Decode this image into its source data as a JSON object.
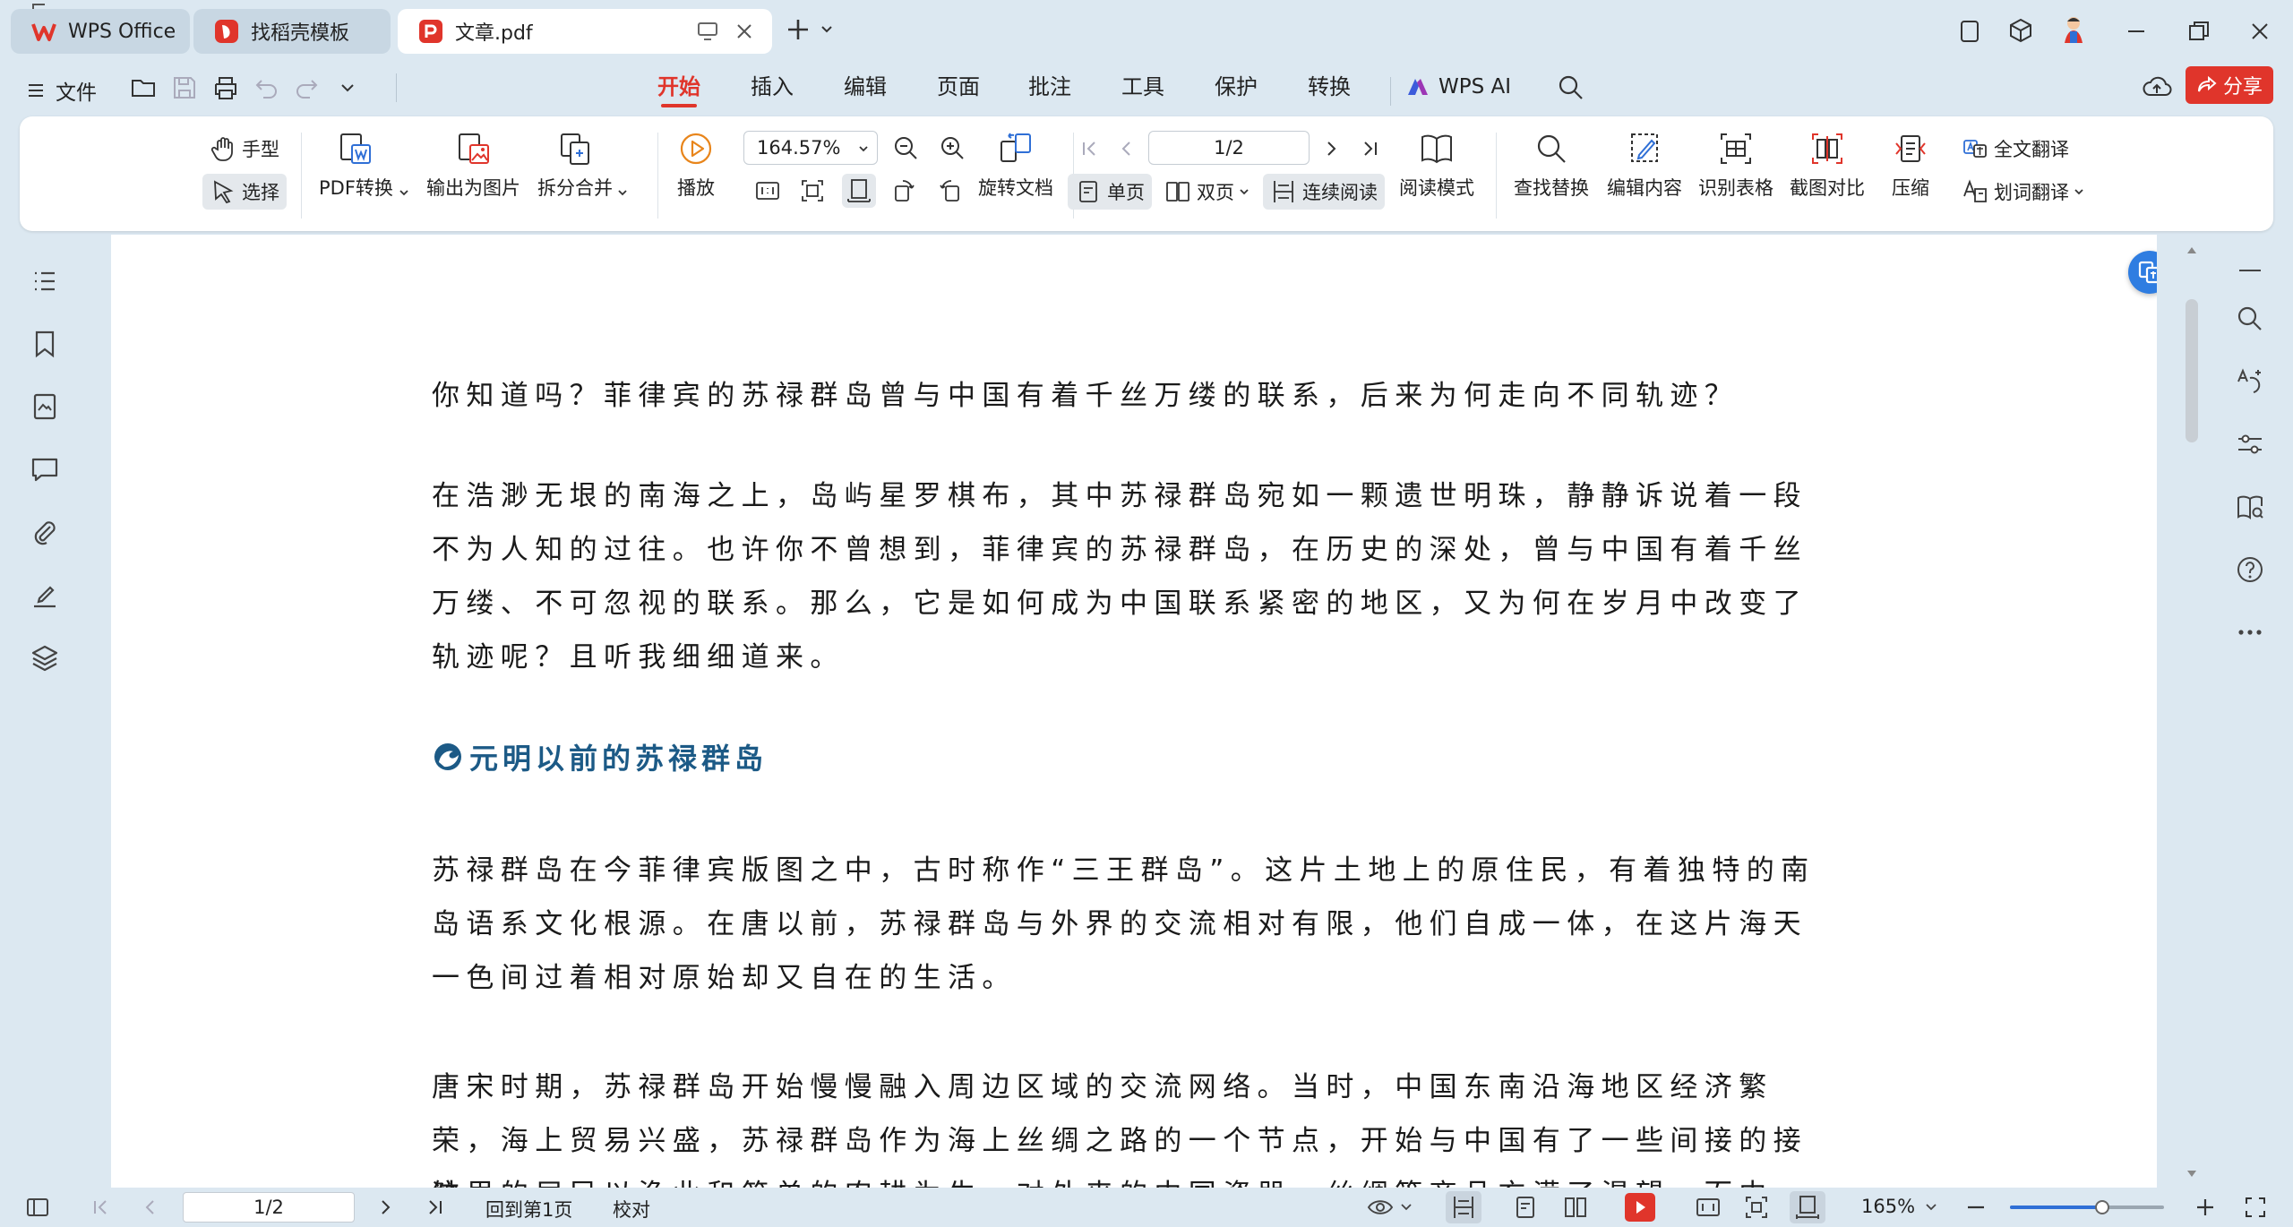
{
  "tabs": [
    {
      "label": "WPS Office",
      "icon": "wps-logo-icon",
      "color": "#e0352b"
    },
    {
      "label": "找稻壳模板",
      "icon": "docer-icon",
      "color": "#e0352b"
    },
    {
      "label": "文章.pdf",
      "icon": "pdf-icon",
      "color": "#e0352b"
    }
  ],
  "menu": {
    "file_label": "文件",
    "tabs": [
      "开始",
      "插入",
      "编辑",
      "页面",
      "批注",
      "工具",
      "保护",
      "转换"
    ],
    "ai_label": "WPS AI",
    "share_label": "分享",
    "accent": "#e0352b"
  },
  "ribbon": {
    "hand": "手型",
    "select": "选择",
    "pdf_convert": "PDF转换",
    "export_image": "输出为图片",
    "split_merge": "拆分合并",
    "play": "播放",
    "zoom_value": "164.57%",
    "page_value": "1/2",
    "rotate_doc": "旋转文档",
    "single_page": "单页",
    "double_page": "双页",
    "continuous": "连续阅读",
    "read_mode": "阅读模式",
    "find_replace": "查找替换",
    "edit_content": "编辑内容",
    "recognize_table": "识别表格",
    "screenshot_compare": "截图对比",
    "compress": "压缩",
    "full_translate": "全文翻译",
    "word_translate": "划词翻译"
  },
  "document": {
    "p1": "你知道吗？菲律宾的苏禄群岛曾与中国有着千丝万缕的联系，后来为何走向不同轨迹？",
    "p2": "在浩渺无垠的南海之上，岛屿星罗棋布，其中苏禄群岛宛如一颗遗世明珠，静静诉说着一段不为人知的过往。也许你不曾想到，菲律宾的苏禄群岛，在历史的深处，曾与中国有着千丝万缕、不可忽视的联系。那么，它是如何成为中国联系紧密的地区，又为何在岁月中改变了轨迹呢？且听我细细道来。",
    "heading": "元明以前的苏禄群岛",
    "p3": "苏禄群岛在今菲律宾版图之中，古时称作“三王群岛”。这片土地上的原住民，有着独特的南岛语系文化根源。在唐以前，苏禄群岛与外界的交流相对有限，他们自成一体，在这片海天一色间过着相对原始却又自在的生活。",
    "p4": "唐宋时期，苏禄群岛开始慢慢融入周边区域的交流网络。当时，中国东南沿海地区经济繁荣，海上贸易兴盛，苏禄群岛作为海上丝绸之路的一个节点，开始与中国有了一些间接的接触。",
    "p5_partial": "这里的居民以渔业和简单的农耕为生，对外来的中国瓷器、丝绸等商品充满了渴望，而中"
  },
  "status": {
    "page_value": "1/2",
    "back_first": "回到第1页",
    "proofread": "校对",
    "zoom": "165%",
    "zoom_fraction": 0.6
  }
}
